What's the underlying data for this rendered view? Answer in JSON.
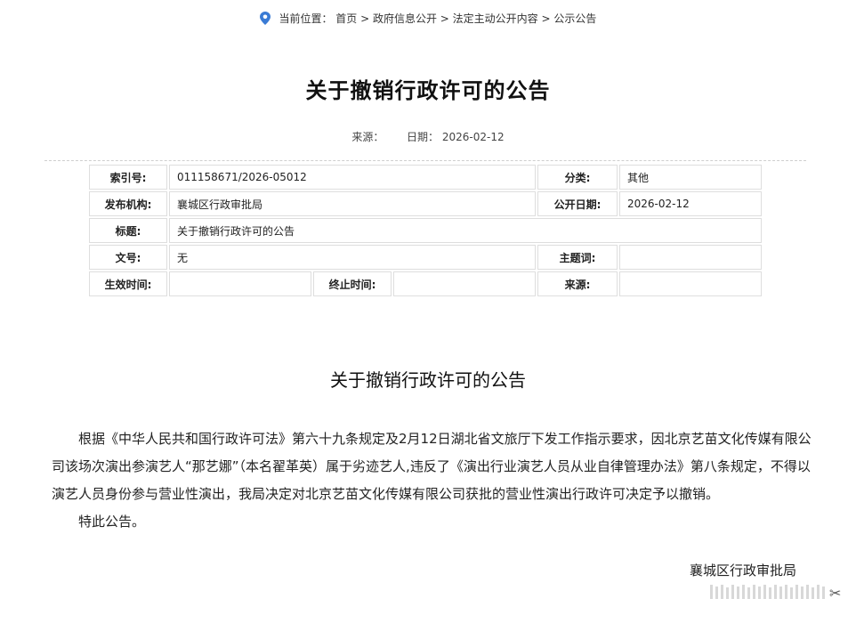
{
  "breadcrumb": {
    "prefix": "当前位置：",
    "path": "首页 > 政府信息公开 > 法定主动公开内容 > 公示公告"
  },
  "page_title": "关于撤销行政许可的公告",
  "meta": {
    "source_label": "来源：",
    "date_label": "日期：",
    "date_value": "2026-02-12"
  },
  "info_table": {
    "index_no_label": "索引号:",
    "index_no_value": "011158671/2026-05012",
    "category_label": "分类:",
    "category_value": "其他",
    "publisher_label": "发布机构:",
    "publisher_value": "襄城区行政审批局",
    "publish_date_label": "公开日期:",
    "publish_date_value": "2026-02-12",
    "subject_label": "标题:",
    "subject_value": "关于撤销行政许可的公告",
    "doc_no_label": "文号:",
    "doc_no_value": "无",
    "keyword_label": "主题词:",
    "keyword_value": "",
    "effective_label": "生效时间:",
    "effective_value": "",
    "end_label": "终止时间:",
    "end_value": "",
    "source_label": "来源:",
    "source_value": ""
  },
  "article": {
    "heading": "关于撤销行政许可的公告",
    "paragraph1": "根据《中华人民共和国行政许可法》第六十九条规定及2月12日湖北省文旅厅下发工作指示要求，因北京艺苗文化传媒有限公司该场次演出参演艺人“那艺娜”（本名翟革英）属于劣迹艺人,违反了《演出行业演艺人员从业自律管理办法》第八条规定，不得以演艺人员身份参与营业性演出，我局决定对北京艺苗文化传媒有限公司获批的营业性演出行政许可决定予以撤销。",
    "paragraph2": "特此公告。",
    "signature": "襄城区行政审批局"
  },
  "colors": {
    "pin": "#3a7bd5",
    "border": "#dedede"
  }
}
